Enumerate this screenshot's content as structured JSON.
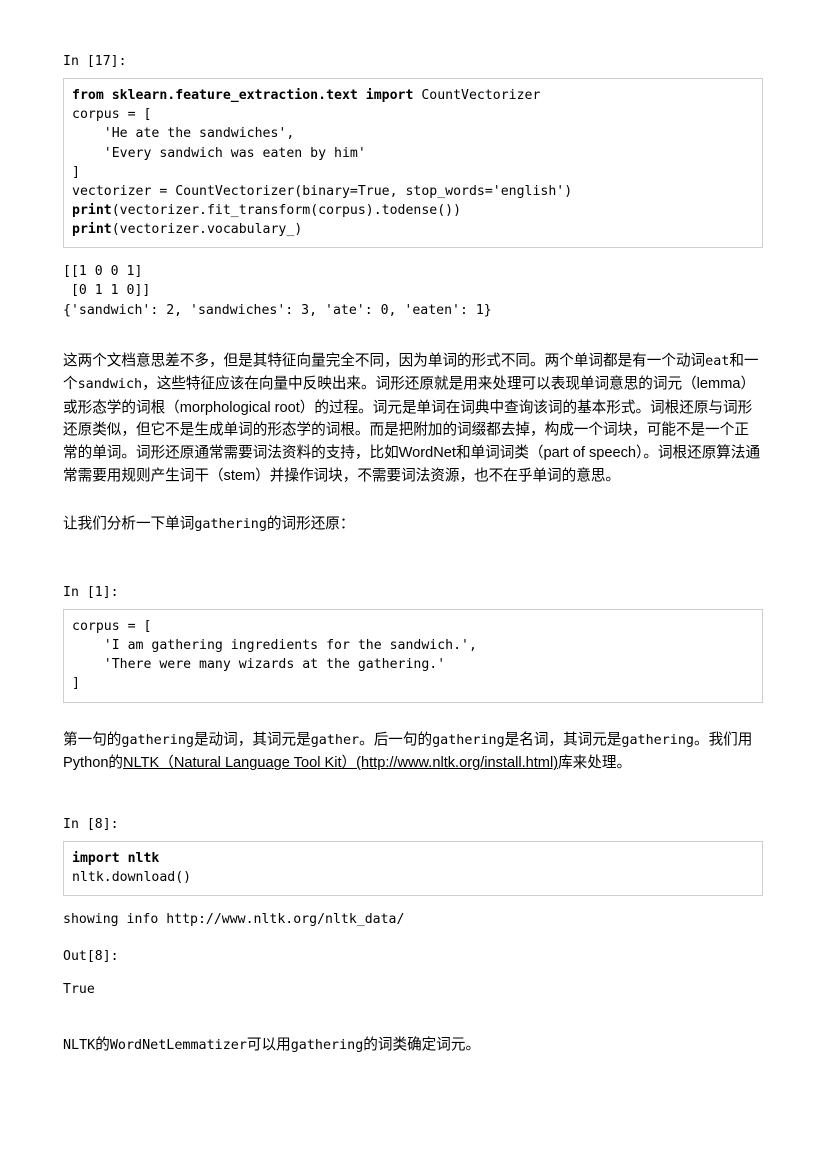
{
  "document": {
    "kind": "jupyter-notebook-export",
    "page_background": "#ffffff",
    "cell_border_color": "#cfcfcf"
  },
  "cells": [
    {
      "id": "cell-1",
      "type": "code",
      "prompt": "In [17]:",
      "source_lines": [
        {
          "bold": "from sklearn.feature_extraction.text import",
          "rest": " CountVectorizer"
        },
        {
          "bold": "",
          "rest": "corpus = ["
        },
        {
          "bold": "",
          "rest": "    'He ate the sandwiches',"
        },
        {
          "bold": "",
          "rest": "    'Every sandwich was eaten by him'"
        },
        {
          "bold": "",
          "rest": "]"
        },
        {
          "bold": "",
          "rest": "vectorizer = CountVectorizer(binary=True, stop_words='english')"
        },
        {
          "bold": "print",
          "rest": "(vectorizer.fit_transform(corpus).todense())"
        },
        {
          "bold": "print",
          "rest": "(vectorizer.vocabulary_)"
        }
      ],
      "output": "[[1 0 0 1]\n [0 1 1 0]]\n{'sandwich': 2, 'sandwiches': 3, 'ate': 0, 'eaten': 1}"
    },
    {
      "id": "cell-2",
      "type": "code",
      "prompt": "In [1]:",
      "source_lines": [
        {
          "bold": "",
          "rest": "corpus = ["
        },
        {
          "bold": "",
          "rest": "    'I am gathering ingredients for the sandwich.',"
        },
        {
          "bold": "",
          "rest": "    'There were many wizards at the gathering.'"
        },
        {
          "bold": "",
          "rest": "]"
        }
      ],
      "output": ""
    },
    {
      "id": "cell-3",
      "type": "code",
      "prompt": "In [8]:",
      "source_lines": [
        {
          "bold": "import nltk",
          "rest": ""
        },
        {
          "bold": "",
          "rest": "nltk.download()"
        }
      ],
      "output": "showing info http://www.nltk.org/nltk_data/",
      "result_prompt": "Out[8]:",
      "result": "True"
    }
  ],
  "markdown": {
    "para_1": {
      "text_a": "这两个文档意思差不多，但是其特征向量完全不同，因为单词的形式不同。两个单词都是有一个动词",
      "mono_a": "eat",
      "text_b": "和一个",
      "mono_b": "sandwich",
      "text_c": "，这些特征应该在向量中反映出来。词形还原就是用来处理可以表现单词意思的词元（lemma）或形态学的词根（morphological root）的过程。词元是单词在词典中查询该词的基本形式。词根还原与词形还原类似，但它不是生成单词的形态学的词根。而是把附加的词缀都去掉，构成一个词块，可能不是一个正常的单词。词形还原通常需要词法资料的支持，比如WordNet和单词词类（part of speech）。词根还原算法通常需要用规则产生词干（stem）并操作词块，不需要词法资源，也不在乎单词的意思。"
    },
    "para_2": {
      "text_a": "让我们分析一下单词",
      "mono_a": "gathering",
      "text_b": "的词形还原："
    },
    "para_3": {
      "text_a": "第一句的",
      "mono_a": "gathering",
      "text_b": "是动词，其词元是",
      "mono_b": "gather",
      "text_c": "。后一句的",
      "mono_c": "gathering",
      "text_d": "是名词，其词元是",
      "mono_d": "gathering",
      "text_e": "。我们用Python的",
      "link_text": "NLTK（Natural Language Tool Kit）(http://www.nltk.org/install.html)",
      "link_href": "http://www.nltk.org/install.html",
      "text_f": "库来处理。"
    },
    "para_4": {
      "mono_a": "NLTK",
      "text_a": "的",
      "mono_b": "WordNetLemmatizer",
      "text_b": "可以用",
      "mono_c": "gathering",
      "text_c": "的词类确定词元。"
    }
  }
}
